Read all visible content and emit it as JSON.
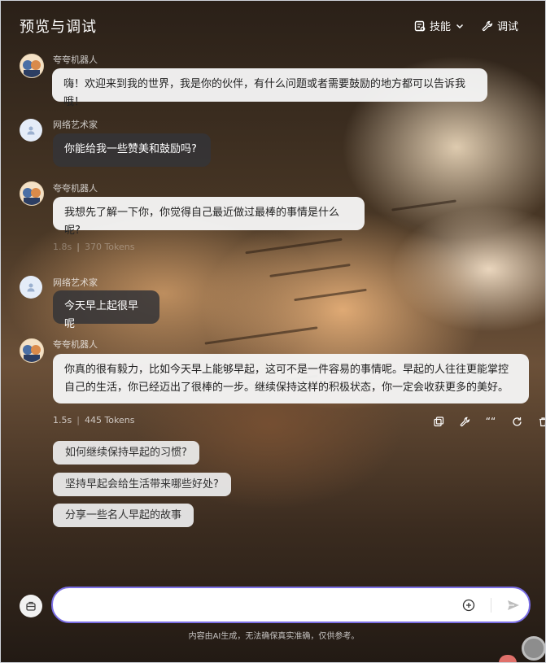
{
  "header": {
    "title": "预览与调试",
    "skills_label": "技能",
    "debug_label": "调试"
  },
  "messages": [
    {
      "role": "bot",
      "name": "夸夸机器人",
      "text": "嗨！欢迎来到我的世界，我是你的伙伴，有什么问题或者需要鼓励的地方都可以告诉我哦！"
    },
    {
      "role": "user",
      "name": "网络艺术家",
      "text": "你能给我一些赞美和鼓励吗?"
    },
    {
      "role": "bot",
      "name": "夸夸机器人",
      "text": "我想先了解一下你，你觉得自己最近做过最棒的事情是什么呢?",
      "meta": {
        "time": "1.8s",
        "tokens": "370 Tokens"
      }
    },
    {
      "role": "user",
      "name": "网络艺术家",
      "text": "今天早上起很早呢"
    },
    {
      "role": "bot",
      "name": "夸夸机器人",
      "text": "你真的很有毅力，比如今天早上能够早起，这可不是一件容易的事情呢。早起的人往往更能掌控自己的生活，你已经迈出了很棒的一步。继续保持这样的积极状态，你一定会收获更多的美好。",
      "meta": {
        "time": "1.5s",
        "tokens": "445 Tokens"
      }
    }
  ],
  "suggestions": [
    "如何继续保持早起的习惯?",
    "坚持早起会给生活带来哪些好处?",
    "分享一些名人早起的故事"
  ],
  "composer": {
    "value": "",
    "placeholder": ""
  },
  "disclaimer": "内容由AI生成，无法确保真实准确，仅供参考。",
  "colors": {
    "accent": "#7b6fe6",
    "bot_bubble": "#f5f5f5",
    "user_bubble": "#343438"
  },
  "icons": [
    "skills-icon",
    "chevron-down-icon",
    "wrench-icon",
    "copy-icon",
    "quote-icon",
    "refresh-icon",
    "trash-icon",
    "plus-circle-icon",
    "send-icon"
  ]
}
